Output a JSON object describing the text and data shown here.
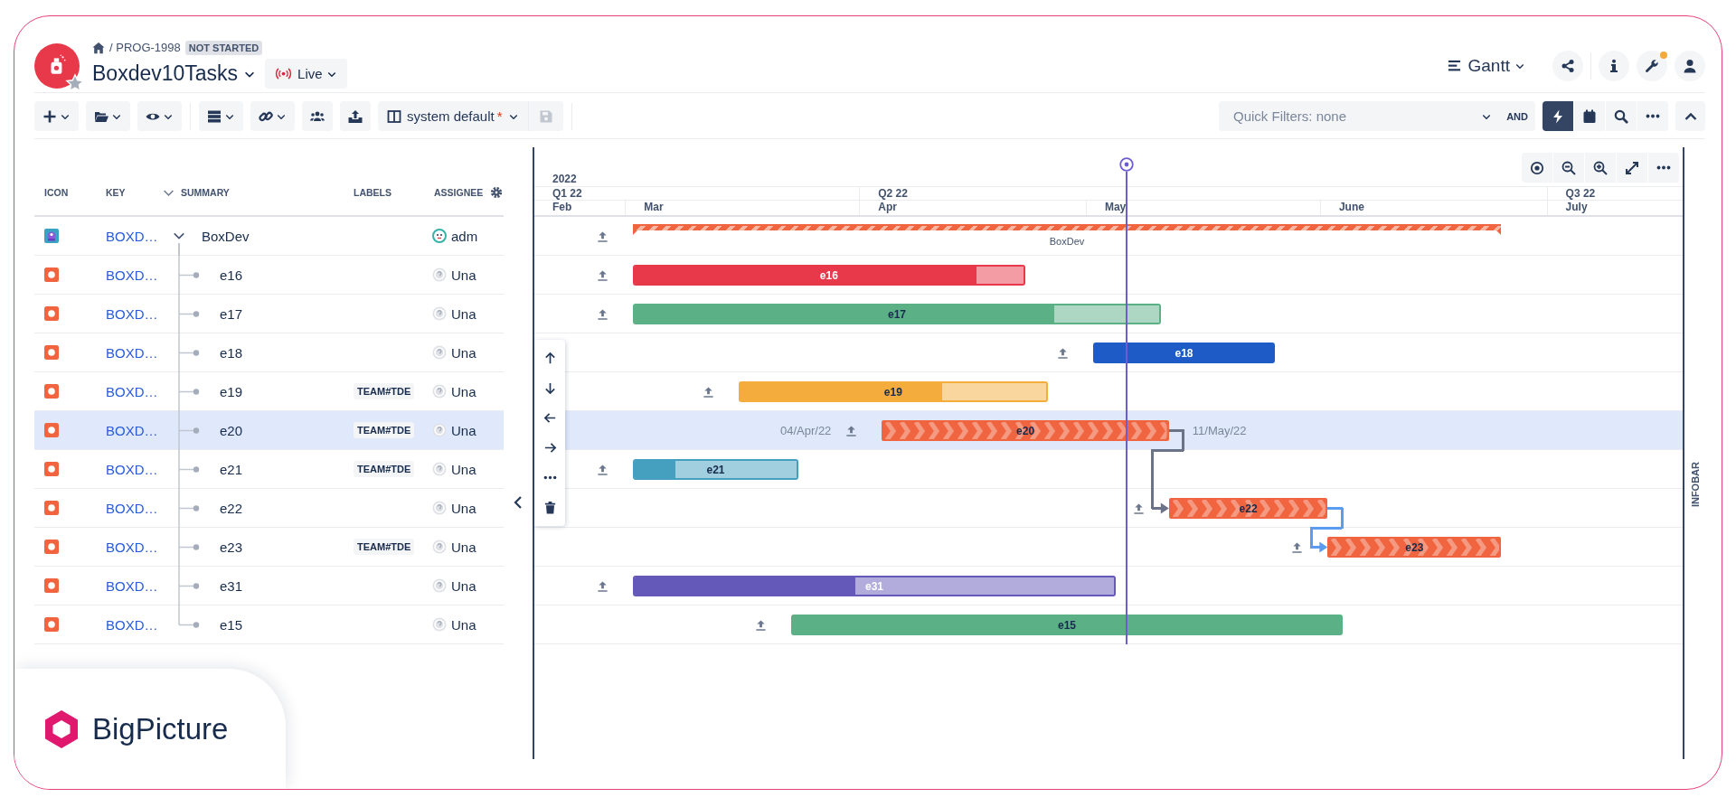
{
  "project": {
    "breadcrumb": "/ PROG-1998",
    "status": "NOT STARTED",
    "title": "Boxdev10Tasks",
    "mode": "Live"
  },
  "view_switcher": {
    "label": "Gantt"
  },
  "header_actions": [
    {
      "kind": "share",
      "notification": false
    },
    {
      "kind": "info",
      "notification": false
    },
    {
      "kind": "tools",
      "notification": true
    },
    {
      "kind": "user",
      "notification": false
    }
  ],
  "toolbar": {
    "groups": [
      [
        {
          "kind": "add",
          "dropdown": true
        },
        {
          "kind": "folder",
          "dropdown": true
        },
        {
          "kind": "view",
          "dropdown": true
        }
      ],
      [
        {
          "kind": "rows",
          "dropdown": true
        },
        {
          "kind": "link",
          "dropdown": true
        },
        {
          "kind": "people",
          "dropdown": false
        },
        {
          "kind": "export",
          "dropdown": false
        }
      ]
    ],
    "view_preset": {
      "label": "system default",
      "modified_mark": "*"
    },
    "save": {
      "disabled": true
    }
  },
  "quick_filters": {
    "placeholder": "Quick Filters: none",
    "operator": "AND"
  },
  "gantt_tools": [
    {
      "kind": "bolt",
      "selected": true
    },
    {
      "kind": "calendar",
      "selected": false
    },
    {
      "kind": "search",
      "selected": false
    },
    {
      "kind": "more",
      "selected": false
    }
  ],
  "table": {
    "columns": [
      {
        "label": "ICON",
        "expander": false
      },
      {
        "label": "KEY",
        "expander": false
      },
      {
        "label": "SUMMARY",
        "expander": true
      },
      {
        "label": "LABELS",
        "expander": false
      },
      {
        "label": "ASSIGNEE",
        "expander": false
      }
    ],
    "rows": [
      {
        "kind": "epic",
        "key": "BOXD…",
        "summary": "BoxDev",
        "expanded": true,
        "assignee": "adm",
        "assigned": true,
        "selected": false,
        "bar": {
          "kind": "summary",
          "color": "#f0643f",
          "label": "BoxDev"
        },
        "children": [
          {
            "kind": "task",
            "key": "BOXD…",
            "summary": "e16",
            "assignee": "Una",
            "assigned": false,
            "selected": false,
            "bar": {
              "kind": "progress",
              "color": "#e8394a",
              "level": 0.88,
              "label": "e16"
            }
          },
          {
            "kind": "task",
            "key": "BOXD…",
            "summary": "e17",
            "assignee": "Una",
            "assigned": false,
            "selected": false,
            "bar": {
              "kind": "progress",
              "color": "#5bb085",
              "level": 0.8,
              "label": "e17"
            }
          },
          {
            "kind": "task",
            "key": "BOXD…",
            "summary": "e18",
            "assignee": "Una",
            "assigned": false,
            "selected": false,
            "bar": {
              "kind": "solid",
              "color": "#1f5bc6",
              "label": "e18"
            }
          },
          {
            "kind": "task",
            "key": "BOXD…",
            "summary": "e19",
            "label": "TEAM#TDE",
            "assignee": "Una",
            "assigned": false,
            "selected": false,
            "bar": {
              "kind": "progress",
              "color": "#f4ad3d",
              "level": 0.66,
              "label": "e19"
            }
          },
          {
            "kind": "task",
            "key": "BOXD…",
            "summary": "e20",
            "label": "TEAM#TDE",
            "assignee": "Una",
            "assigned": false,
            "selected": true,
            "bar": {
              "kind": "chevron",
              "color": "#f0643f",
              "label": "e20",
              "start_label": "04/Apr/22",
              "end_label": "11/May/22"
            }
          },
          {
            "kind": "task",
            "key": "BOXD…",
            "summary": "e21",
            "label": "TEAM#TDE",
            "assignee": "Una",
            "assigned": false,
            "selected": false,
            "bar": {
              "kind": "progress",
              "color": "#45a0bf",
              "level": 0.25,
              "label": "e21"
            }
          },
          {
            "kind": "task",
            "key": "BOXD…",
            "summary": "e22",
            "assignee": "Una",
            "assigned": false,
            "selected": false,
            "bar": {
              "kind": "chevron",
              "color": "#f0643f",
              "label": "e22",
              "dependency": {
                "color": "#6b7388"
              }
            }
          },
          {
            "kind": "task",
            "key": "BOXD…",
            "summary": "e23",
            "label": "TEAM#TDE",
            "assignee": "Una",
            "assigned": false,
            "selected": false,
            "bar": {
              "kind": "chevron",
              "color": "#f0643f",
              "label": "e23",
              "dependency": {
                "color": "#5b9cf0"
              }
            }
          },
          {
            "kind": "task",
            "key": "BOXD…",
            "summary": "e31",
            "assignee": "Una",
            "assigned": false,
            "selected": false,
            "bar": {
              "kind": "progress",
              "color": "#6459b8",
              "level": 0.46,
              "label": "e31"
            }
          },
          {
            "kind": "task",
            "key": "BOXD…",
            "summary": "e15",
            "assignee": "Una",
            "assigned": false,
            "selected": false,
            "bar": {
              "kind": "solid",
              "color": "#5bb085",
              "label": "e15"
            }
          }
        ]
      }
    ]
  },
  "timeline": {
    "year": "2022",
    "quarters": [
      "Q1 22",
      "Q2 22",
      "Q3 22"
    ],
    "months": [
      "Feb",
      "Mar",
      "Apr",
      "May",
      "June",
      "July"
    ]
  },
  "infobar": {
    "label": "INFOBAR"
  },
  "brand": {
    "name": "BigPicture"
  }
}
